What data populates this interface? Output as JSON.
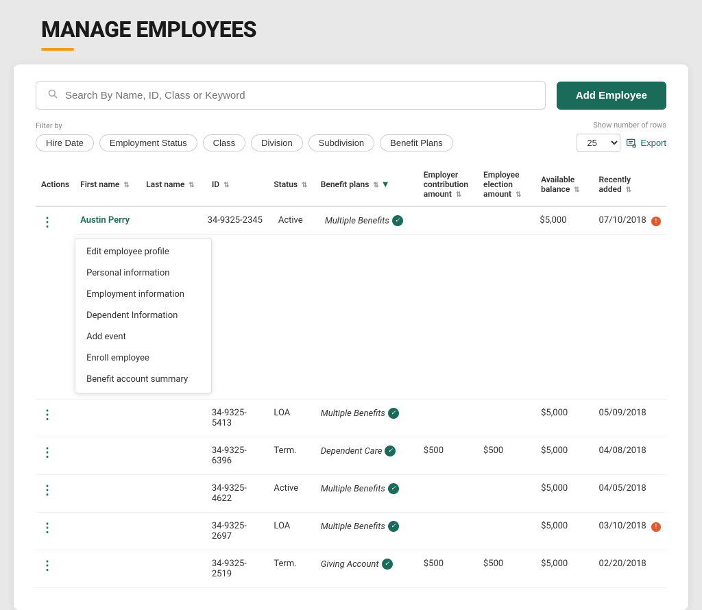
{
  "page": {
    "title": "MANAGE EMPLOYEES",
    "title_underline_color": "#e8a020"
  },
  "search": {
    "placeholder": "Search By Name, ID, Class or Keyword"
  },
  "add_button": {
    "label": "Add Employee"
  },
  "filter": {
    "label": "Filter by",
    "chips": [
      "Hire Date",
      "Employment Status",
      "Class",
      "Division",
      "Subdivision",
      "Benefit Plans"
    ]
  },
  "rows": {
    "label": "Show number of rows",
    "value": "25"
  },
  "export": {
    "label": "Export"
  },
  "table": {
    "headers": [
      {
        "label": "Actions",
        "sortable": false
      },
      {
        "label": "First name",
        "sortable": true
      },
      {
        "label": "Last name",
        "sortable": true
      },
      {
        "label": "ID",
        "sortable": true
      },
      {
        "label": "Status",
        "sortable": true
      },
      {
        "label": "Benefit plans",
        "sortable": true
      },
      {
        "label": "Employer contribution amount",
        "sortable": true
      },
      {
        "label": "Employee election amount",
        "sortable": true
      },
      {
        "label": "Available balance",
        "sortable": true
      },
      {
        "label": "Recently added",
        "sortable": true
      }
    ],
    "rows": [
      {
        "id": "row-1",
        "first_name": "Austin Perry",
        "last_name": "",
        "employee_id": "34-9325-2345",
        "status": "Active",
        "benefit_plans": "Multiple Benefits",
        "employer_contribution": "",
        "employee_election": "",
        "available_balance": "$5,000",
        "recently_added": "07/10/2018",
        "warning": true,
        "open": true
      },
      {
        "id": "row-2",
        "first_name": "",
        "last_name": "",
        "employee_id": "34-9325-5413",
        "status": "LOA",
        "benefit_plans": "Multiple Benefits",
        "employer_contribution": "",
        "employee_election": "",
        "available_balance": "$5,000",
        "recently_added": "05/09/2018",
        "warning": false,
        "open": false
      },
      {
        "id": "row-3",
        "first_name": "",
        "last_name": "",
        "employee_id": "34-9325-6396",
        "status": "Term.",
        "benefit_plans": "Dependent Care",
        "employer_contribution": "$500",
        "employee_election": "$500",
        "available_balance": "$5,000",
        "recently_added": "04/08/2018",
        "warning": false,
        "open": false
      },
      {
        "id": "row-4",
        "first_name": "",
        "last_name": "",
        "employee_id": "34-9325-4622",
        "status": "Active",
        "benefit_plans": "Multiple Benefits",
        "employer_contribution": "",
        "employee_election": "",
        "available_balance": "$5,000",
        "recently_added": "04/05/2018",
        "warning": false,
        "open": false
      },
      {
        "id": "row-5",
        "first_name": "",
        "last_name": "",
        "employee_id": "34-9325-2697",
        "status": "LOA",
        "benefit_plans": "Multiple Benefits",
        "employer_contribution": "",
        "employee_election": "",
        "available_balance": "$5,000",
        "recently_added": "03/10/2018",
        "warning": true,
        "open": false
      },
      {
        "id": "row-6",
        "first_name": "",
        "last_name": "",
        "employee_id": "34-9325-2519",
        "status": "Term.",
        "benefit_plans": "Giving Account",
        "employer_contribution": "$500",
        "employee_election": "$500",
        "available_balance": "$5,000",
        "recently_added": "02/20/2018",
        "warning": false,
        "open": false
      }
    ],
    "dropdown_items": [
      "Edit employee profile",
      "Personal information",
      "Employment information",
      "Dependent Information",
      "Add event",
      "Enroll employee",
      "Benefit account summary"
    ]
  }
}
